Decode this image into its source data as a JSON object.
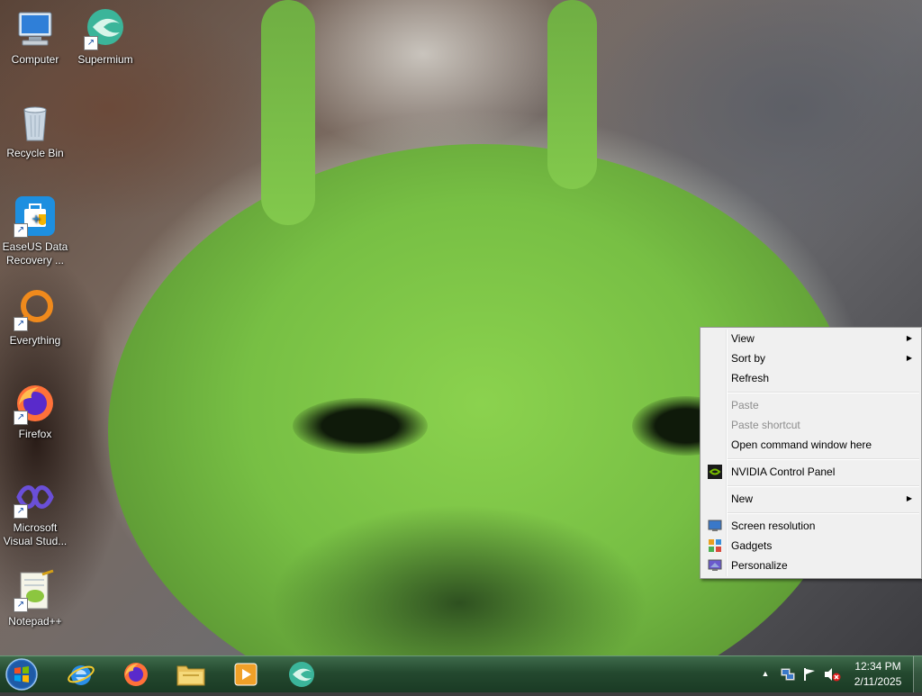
{
  "desktop": {
    "icons": [
      {
        "label": "Computer",
        "icon": "computer-icon"
      },
      {
        "label": "Supermium",
        "icon": "supermium-icon"
      },
      {
        "label": "Recycle Bin",
        "icon": "recycle-bin-icon"
      },
      {
        "label": "EaseUS Data",
        "label2": "Recovery ...",
        "icon": "easeus-icon"
      },
      {
        "label": "Everything",
        "icon": "everything-icon"
      },
      {
        "label": "Firefox",
        "icon": "firefox-icon"
      },
      {
        "label": "Microsoft",
        "label2": "Visual Stud...",
        "icon": "visual-studio-icon"
      },
      {
        "label": "Notepad++",
        "icon": "notepadpp-icon"
      }
    ]
  },
  "context_menu": {
    "items": [
      {
        "label": "View",
        "submenu": true,
        "enabled": true
      },
      {
        "label": "Sort by",
        "submenu": true,
        "enabled": true
      },
      {
        "label": "Refresh",
        "enabled": true
      },
      {
        "label": "Paste",
        "enabled": false
      },
      {
        "label": "Paste shortcut",
        "enabled": false
      },
      {
        "label": "Open command window here",
        "enabled": true
      },
      {
        "label": "NVIDIA Control Panel",
        "enabled": true,
        "icon": "nvidia-icon"
      },
      {
        "label": "New",
        "submenu": true,
        "enabled": true
      },
      {
        "label": "Screen resolution",
        "enabled": true,
        "icon": "screen-resolution-icon"
      },
      {
        "label": "Gadgets",
        "enabled": true,
        "icon": "gadgets-icon"
      },
      {
        "label": "Personalize",
        "enabled": true,
        "icon": "personalize-icon"
      }
    ]
  },
  "taskbar": {
    "pinned": [
      "internet-explorer-icon",
      "firefox-icon",
      "file-explorer-icon",
      "media-player-icon",
      "supermium-icon"
    ],
    "clock": {
      "time": "12:34 PM",
      "date": "2/11/2025"
    }
  },
  "colors": {
    "menu_bg": "#f0f0f0",
    "taskbar": "#24492f",
    "wallpaper_green": "#7cc34a"
  }
}
